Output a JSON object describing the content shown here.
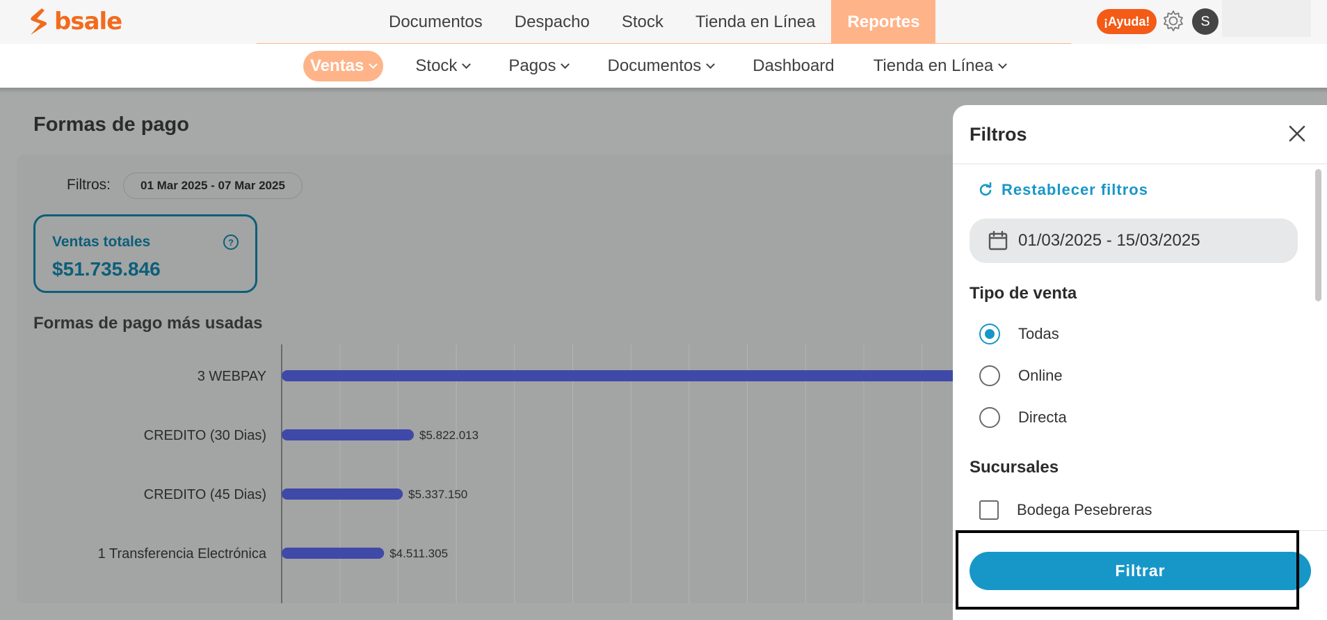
{
  "brand": {
    "name": "bsale",
    "accent": "#f26b1d"
  },
  "main_nav": [
    {
      "label": "Documentos"
    },
    {
      "label": "Despacho"
    },
    {
      "label": "Stock"
    },
    {
      "label": "Tienda en Línea"
    },
    {
      "label": "Reportes",
      "active": true
    }
  ],
  "header_actions": {
    "help_label": "¡Ayuda!",
    "settings_icon": "gear-icon",
    "avatar_initial": "S"
  },
  "sub_nav": [
    {
      "label": "Ventas",
      "active": true,
      "dropdown": true
    },
    {
      "label": "Stock",
      "dropdown": true
    },
    {
      "label": "Pagos",
      "dropdown": true
    },
    {
      "label": "Documentos",
      "dropdown": true
    },
    {
      "label": "Dashboard",
      "dropdown": false
    },
    {
      "label": "Tienda en Línea",
      "dropdown": true
    }
  ],
  "page": {
    "title": "Formas de pago",
    "filters_label": "Filtros:",
    "date_range_chip": "01 Mar 2025 - 07 Mar 2025",
    "kpi": {
      "label": "Ventas totales",
      "value": "$51.735.846",
      "help_icon": "help-icon"
    },
    "chart_title": "Formas de pago más usadas"
  },
  "chart_data": {
    "type": "bar",
    "orientation": "horizontal",
    "categories": [
      "3 WEBPAY",
      "CREDITO (30 Dias)",
      "CREDITO (45 Dias)",
      "1 Transferencia Electrónica"
    ],
    "values": [
      null,
      5822013,
      5337150,
      4511305
    ],
    "value_labels": [
      "",
      "$5.822.013",
      "$5.337.150",
      "$4.511.305"
    ],
    "bar_color": "#3f49a8",
    "grid": true,
    "note_hidden": "first bar extends beyond the overlaying filter panel"
  },
  "filter_panel": {
    "title": "Filtros",
    "close_icon": "close-icon",
    "reset_label": "Restablecer filtros",
    "date_value": "01/03/2025 - 15/03/2025",
    "sale_type": {
      "title": "Tipo de venta",
      "options": [
        {
          "label": "Todas",
          "checked": true
        },
        {
          "label": "Online",
          "checked": false
        },
        {
          "label": "Directa",
          "checked": false
        }
      ]
    },
    "branches": {
      "title": "Sucursales",
      "options": [
        {
          "label": "Bodega Pesebreras",
          "checked": false
        }
      ]
    },
    "submit_label": "Filtrar",
    "accent": "#1797c7"
  }
}
